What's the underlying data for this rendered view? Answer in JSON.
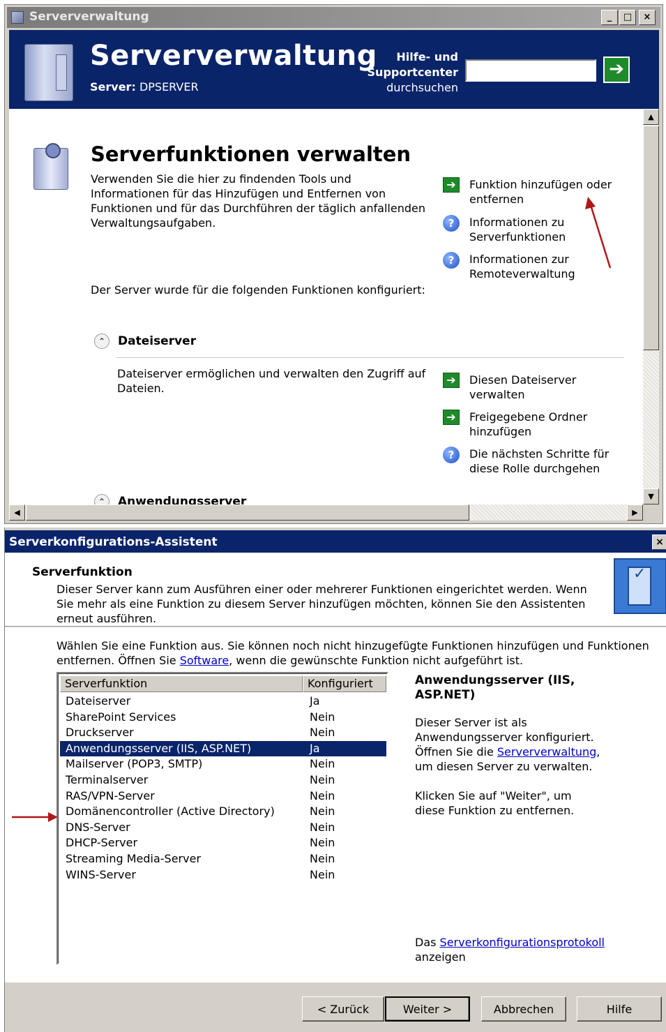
{
  "window1": {
    "title": "Serververwaltung",
    "header": {
      "title": "Serververwaltung",
      "server_label": "Server:",
      "server_name": "DPSERVER",
      "help_line1": "Hilfe- und",
      "help_line2": "Supportcenter",
      "help_line3": "durchsuchen",
      "search_value": "",
      "go_icon": "go-arrow-icon"
    },
    "main": {
      "heading": "Serverfunktionen verwalten",
      "description": "Verwenden Sie die hier zu findenden Tools und Informationen für das Hinzufügen und Entfernen von Funktionen und für das Durchführen der täglich anfallenden Verwaltungsaufgaben.",
      "configured_note": "Der Server wurde für die folgenden Funktionen konfiguriert:",
      "actions": [
        {
          "label": "Funktion hinzufügen oder entfernen",
          "icon": "green-arrow-icon"
        },
        {
          "label": "Informationen zu Serverfunktionen",
          "icon": "help-icon"
        },
        {
          "label": "Informationen zur Remoteverwaltung",
          "icon": "help-icon"
        }
      ],
      "sections": [
        {
          "title": "Dateiserver",
          "description": "Dateiserver ermöglichen und verwalten den Zugriff auf Dateien.",
          "actions": [
            {
              "label": "Diesen Dateiserver verwalten",
              "icon": "green-arrow-icon"
            },
            {
              "label": "Freigegebene Ordner hinzufügen",
              "icon": "green-arrow-icon"
            },
            {
              "label": "Die nächsten Schritte für diese Rolle durchgehen",
              "icon": "help-icon"
            }
          ]
        },
        {
          "title": "Anwendungsserver"
        }
      ]
    }
  },
  "window2": {
    "title": "Serverkonfigurations-Assistent",
    "close": "×",
    "heading": "Serverfunktion",
    "description": "Dieser Server kann zum Ausführen einer oder mehrerer Funktionen eingerichtet werden. Wenn Sie mehr als eine Funktion zu diesem Server hinzufügen möchten, können Sie den Assistenten erneut ausführen.",
    "intro_before": "Wählen Sie eine Funktion aus. Sie können noch nicht hinzugefügte Funktionen hinzufügen und Funktionen entfernen. Öffnen Sie ",
    "intro_link": "Software",
    "intro_after": ", wenn die gewünschte Funktion nicht aufgeführt ist.",
    "table": {
      "columns": [
        "Serverfunktion",
        "Konfiguriert"
      ],
      "selected_index": 3,
      "rows": [
        [
          "Dateiserver",
          "Ja"
        ],
        [
          "SharePoint Services",
          "Nein"
        ],
        [
          "Druckserver",
          "Nein"
        ],
        [
          "Anwendungsserver (IIS, ASP.NET)",
          "Ja"
        ],
        [
          "Mailserver (POP3, SMTP)",
          "Nein"
        ],
        [
          "Terminalserver",
          "Nein"
        ],
        [
          "RAS/VPN-Server",
          "Nein"
        ],
        [
          "Domänencontroller (Active Directory)",
          "Nein"
        ],
        [
          "DNS-Server",
          "Nein"
        ],
        [
          "DHCP-Server",
          "Nein"
        ],
        [
          "Streaming Media-Server",
          "Nein"
        ],
        [
          "WINS-Server",
          "Nein"
        ]
      ]
    },
    "side": {
      "title": "Anwendungsserver (IIS, ASP.NET)",
      "p1_before": "Dieser Server ist als Anwendungsserver konfiguriert. Öffnen Sie die ",
      "p1_link": "Serververwaltung",
      "p1_after": ", um diesen Server zu verwalten.",
      "p2": "Klicken Sie auf \"Weiter\", um diese Funktion zu entfernen.",
      "p3_before": "Das ",
      "p3_link": "Serverkonfigurationsprotokoll",
      "p3_after": " anzeigen"
    },
    "buttons": {
      "back": "< Zurück",
      "next": "Weiter >",
      "cancel": "Abbrechen",
      "help": "Hilfe"
    }
  },
  "colors": {
    "header_bg": "#0a246a",
    "selection_bg": "#0a246a",
    "annotation_red": "#b01818",
    "go_green": "#1f8a2a"
  }
}
